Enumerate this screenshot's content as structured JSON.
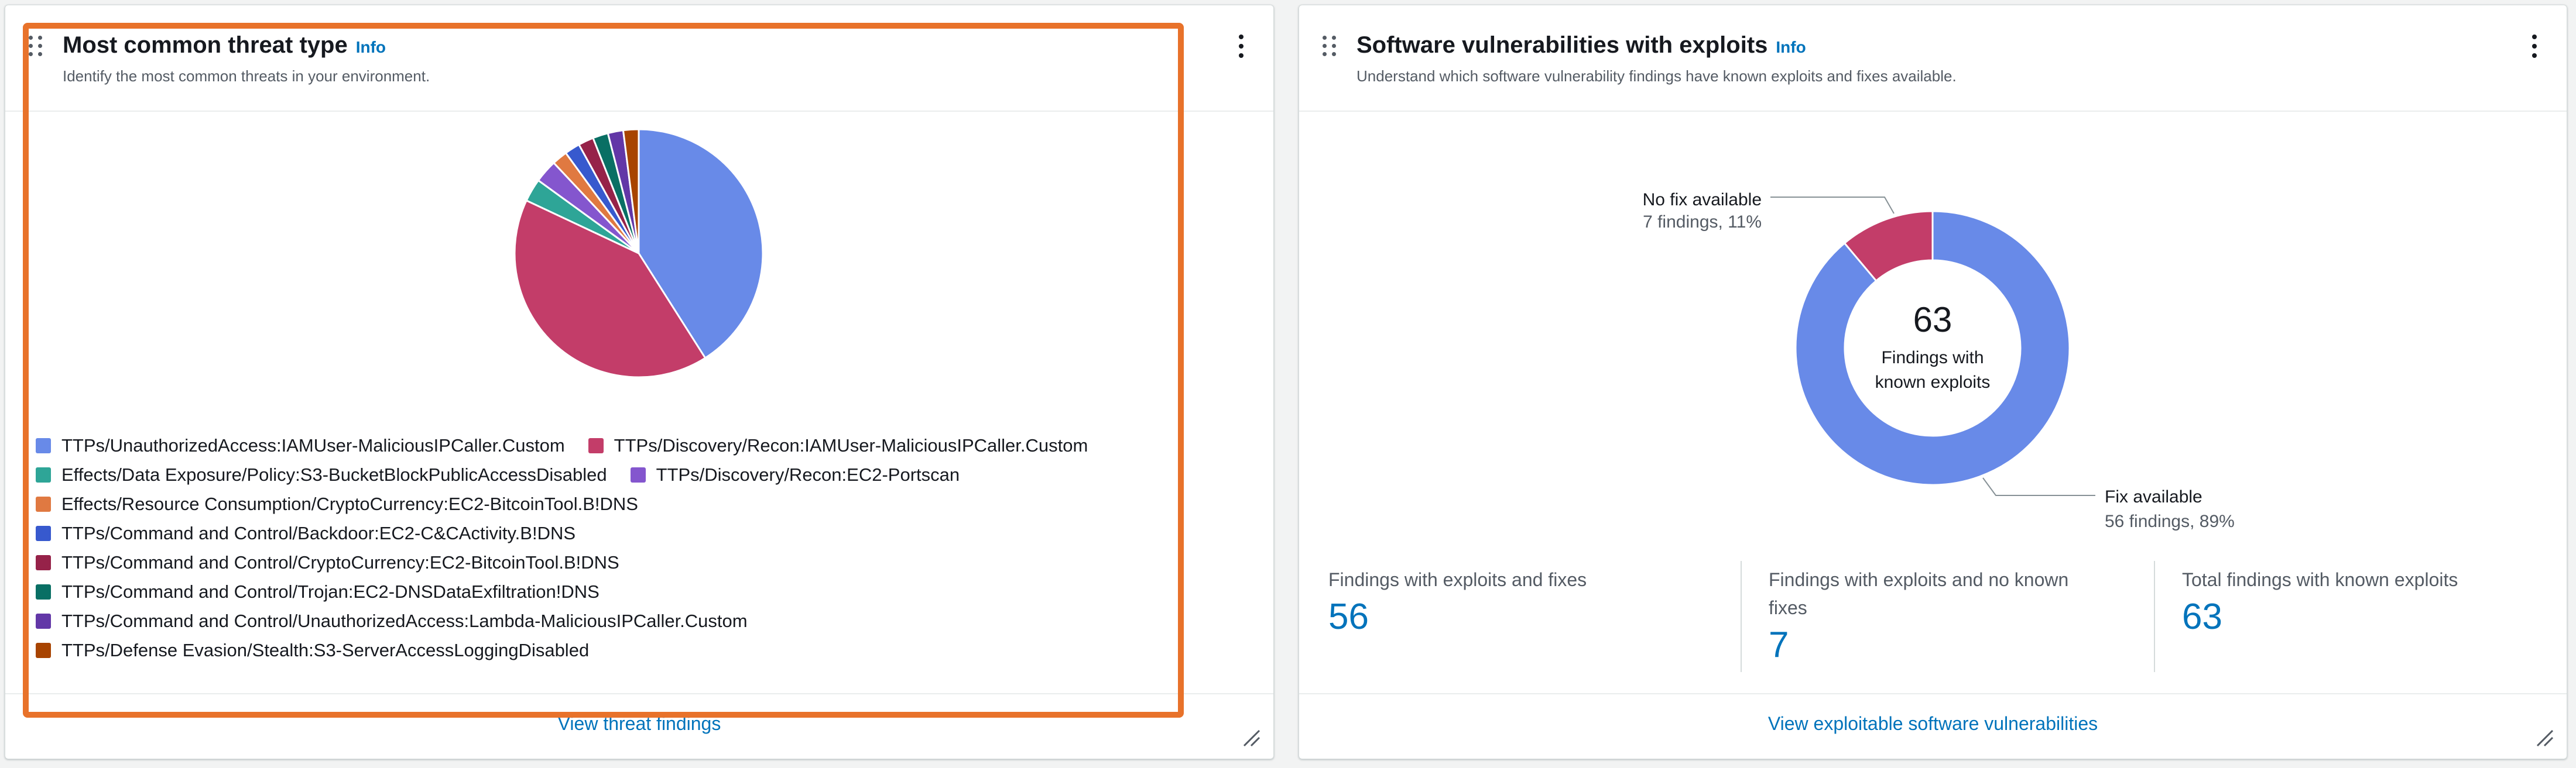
{
  "widget1": {
    "title": "Most common threat type",
    "info": "Info",
    "description": "Identify the most common threats in your environment.",
    "footer_link": "View threat findings",
    "chart_data": {
      "type": "pie",
      "title": "",
      "legend_position": "bottom",
      "slices": [
        {
          "label": "TTPs/UnauthorizedAccess:IAMUser-MaliciousIPCaller.Custom",
          "value": 41,
          "color": "#688ae8"
        },
        {
          "label": "TTPs/Discovery/Recon:IAMUser-MaliciousIPCaller.Custom",
          "value": 41,
          "color": "#c33d69"
        },
        {
          "label": "Effects/Data Exposure/Policy:S3-BucketBlockPublicAccessDisabled",
          "value": 3,
          "color": "#2ea597"
        },
        {
          "label": "TTPs/Discovery/Recon:EC2-Portscan",
          "value": 3,
          "color": "#8456ce"
        },
        {
          "label": "Effects/Resource Consumption/CryptoCurrency:EC2-BitcoinTool.B!DNS",
          "value": 2,
          "color": "#e07941"
        },
        {
          "label": "TTPs/Command and Control/Backdoor:EC2-C&CActivity.B!DNS",
          "value": 2,
          "color": "#3759ce"
        },
        {
          "label": "TTPs/Command and Control/CryptoCurrency:EC2-BitcoinTool.B!DNS",
          "value": 2,
          "color": "#962249"
        },
        {
          "label": "TTPs/Command and Control/Trojan:EC2-DNSDataExfiltration!DNS",
          "value": 2,
          "color": "#096f64"
        },
        {
          "label": "TTPs/Command and Control/UnauthorizedAccess:Lambda-MaliciousIPCaller.Custom",
          "value": 2,
          "color": "#6237a7"
        },
        {
          "label": "TTPs/Defense Evasion/Stealth:S3-ServerAccessLoggingDisabled",
          "value": 2,
          "color": "#a84401"
        }
      ]
    }
  },
  "widget2": {
    "title": "Software vulnerabilities with exploits",
    "info": "Info",
    "description": "Understand which software vulnerability findings have known exploits and fixes available.",
    "footer_link": "View exploitable software vulnerabilities",
    "chart_data": {
      "type": "pie",
      "variant": "donut",
      "center_value": "63",
      "center_label_line1": "Findings with",
      "center_label_line2": "known exploits",
      "slices": [
        {
          "label": "Fix available",
          "detail": "56 findings, 89%",
          "value": 56,
          "color": "#688ae8"
        },
        {
          "label": "No fix available",
          "detail": "7 findings, 11%",
          "value": 7,
          "color": "#c33d69"
        }
      ]
    },
    "stats": [
      {
        "label": "Findings with exploits and fixes",
        "value": "56"
      },
      {
        "label_line1": "Findings with exploits and no known",
        "label_line2": "fixes",
        "value": "7"
      },
      {
        "label": "Total findings with known exploits",
        "value": "63"
      }
    ]
  },
  "colors": {
    "link": "#0073bb",
    "highlight_border": "#e8722a"
  }
}
